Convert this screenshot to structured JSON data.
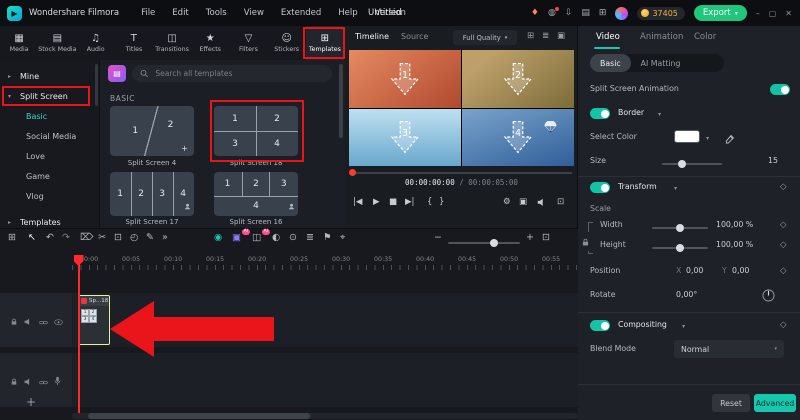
{
  "ui": {
    "caret_down": "▾",
    "diamond": "◇"
  },
  "annotations": {
    "color": "#ea1518"
  },
  "menubar": {
    "app_name": "Wondershare Filmora",
    "menu_items": [
      "File",
      "Edit",
      "Tools",
      "View",
      "Extended",
      "Help",
      "Version"
    ],
    "project_title": "Untitled",
    "status_icons": [
      {
        "name": "gift-icon",
        "glyph": "♦"
      },
      {
        "name": "notification-bell-icon",
        "glyph": "◍"
      },
      {
        "name": "download-icon",
        "glyph": "⇩"
      },
      {
        "name": "device-connect-icon",
        "glyph": "▤"
      },
      {
        "name": "workspace-layout-icon",
        "glyph": "⊞"
      }
    ],
    "coin_count": "37405",
    "export_label": "Export",
    "window_minimize": "–",
    "window_maximize": "▢",
    "window_close": "✕"
  },
  "media_toolbar": {
    "tabs": [
      {
        "label": "Media",
        "icon": "▦"
      },
      {
        "label": "Stock Media",
        "icon": "▤"
      },
      {
        "label": "Audio",
        "icon": "♫"
      },
      {
        "label": "Titles",
        "icon": "T"
      },
      {
        "label": "Transitions",
        "icon": "◫"
      },
      {
        "label": "Effects",
        "icon": "★"
      },
      {
        "label": "Filters",
        "icon": "▽"
      },
      {
        "label": "Stickers",
        "icon": "☺"
      },
      {
        "label": "Templates",
        "icon": "⊞"
      }
    ]
  },
  "sidebar": {
    "items": [
      {
        "label": "Mine",
        "chevron": "▸"
      },
      {
        "label": "Split Screen",
        "chevron": "▾"
      },
      {
        "label": "Basic"
      },
      {
        "label": "Social Media"
      },
      {
        "label": "Love"
      },
      {
        "label": "Game"
      },
      {
        "label": "Vlog"
      },
      {
        "label": "Templates",
        "chevron": "▸"
      }
    ]
  },
  "templates_panel": {
    "search_placeholder": "Search all templates",
    "section_label": "BASIC",
    "items": [
      {
        "name": "Split Screen 4",
        "cells": [
          "1",
          "2",
          "+"
        ]
      },
      {
        "name": "Split Screen 18",
        "cells": [
          "1",
          "2",
          "3",
          "4"
        ]
      },
      {
        "name": "Split Screen 17",
        "cells": [
          "1",
          "2",
          "3",
          "4"
        ]
      },
      {
        "name": "Split Screen 16",
        "cells": [
          "1",
          "2",
          "3",
          "4"
        ]
      }
    ]
  },
  "preview": {
    "tabs": [
      "Timeline",
      "Source"
    ],
    "quality_label": "Full Quality",
    "header_icons": [
      {
        "name": "grid-view-icon",
        "glyph": "⊞"
      },
      {
        "name": "adjust-icon",
        "glyph": "≣"
      },
      {
        "name": "frame-icon",
        "glyph": "▣"
      }
    ],
    "quadrant_numbers": [
      "1",
      "2",
      "3",
      "4"
    ],
    "current_time": "00:00:00:00",
    "separator": "/",
    "total_time": "00:00:05:00",
    "transport": [
      {
        "name": "previous-frame-icon",
        "glyph": "|◀"
      },
      {
        "name": "play-icon",
        "glyph": "▶"
      },
      {
        "name": "stop-icon",
        "glyph": "■"
      },
      {
        "name": "next-frame-icon",
        "glyph": "▶|"
      },
      {
        "name": "mark-in-icon",
        "glyph": "{"
      },
      {
        "name": "mark-out-icon",
        "glyph": "}"
      }
    ],
    "right_controls": [
      {
        "name": "settings-gear-icon",
        "glyph": "⚙"
      },
      {
        "name": "snapshot-camera-icon",
        "glyph": "▣"
      },
      {
        "name": "fullscreen-icon",
        "glyph": "⊡"
      }
    ]
  },
  "properties": {
    "accent_color": "#16c8ae",
    "tabs": [
      "Video",
      "Animation",
      "Color"
    ],
    "subtabs": [
      "Basic",
      "AI Matting"
    ],
    "split_screen_animation_label": "Split Screen Animation",
    "border_label": "Border",
    "select_color_label": "Select Color",
    "size_label": "Size",
    "size_value": "15",
    "transform_label": "Transform",
    "scale_label": "Scale",
    "width_label": "Width",
    "width_value": "100,00 %",
    "height_label": "Height",
    "height_value": "100,00 %",
    "position_label": "Position",
    "position_x_label": "X",
    "position_x_value": "0,00",
    "position_y_label": "Y",
    "position_y_value": "0,00",
    "rotate_label": "Rotate",
    "rotate_value": "0,00°",
    "compositing_label": "Compositing",
    "blend_mode_label": "Blend Mode",
    "blend_mode_value": "Normal",
    "reset_label": "Reset",
    "advanced_label": "Advanced"
  },
  "timeline": {
    "tools": [
      {
        "name": "track-manager-icon",
        "glyph": "⊞"
      },
      {
        "name": "pointer-tool-icon",
        "glyph": "↖"
      },
      {
        "name": "undo-icon",
        "glyph": "↶"
      },
      {
        "name": "redo-icon",
        "glyph": "↷"
      },
      {
        "name": "delete-icon",
        "glyph": "⌦"
      },
      {
        "name": "split-scissors-icon",
        "glyph": "✂"
      },
      {
        "name": "crop-icon",
        "glyph": "⊡"
      },
      {
        "name": "speed-icon",
        "glyph": "◴"
      },
      {
        "name": "edit-pen-icon",
        "glyph": "✎"
      },
      {
        "name": "more-tools-icon",
        "glyph": "»"
      },
      {
        "name": "chroma-key-icon",
        "glyph": "◉"
      },
      {
        "name": "ai-portrait-icon",
        "glyph": "▣"
      },
      {
        "name": "ai-tools-icon",
        "glyph": "◫"
      },
      {
        "name": "mask-icon",
        "glyph": "◐"
      },
      {
        "name": "motion-track-icon",
        "glyph": "⊙"
      },
      {
        "name": "audio-mixer-icon",
        "glyph": "≣"
      },
      {
        "name": "marker-icon",
        "glyph": "⚑"
      },
      {
        "name": "keyframe-icon",
        "glyph": "⌖"
      }
    ],
    "ai_badge": "AI",
    "zoom_out_label": "−",
    "zoom_in_label": "+",
    "zoom_fit_glyph": "⊡",
    "ruler_labels": [
      "00:00",
      "00:05",
      "00:10",
      "00:15",
      "00:20",
      "00:25",
      "00:30",
      "00:35",
      "00:40",
      "00:45",
      "00:50",
      "00:55"
    ],
    "clip": {
      "label": "Sp...18",
      "thumb_numbers": [
        "1",
        "2",
        "3",
        "4"
      ]
    },
    "add_track_label": "+"
  }
}
